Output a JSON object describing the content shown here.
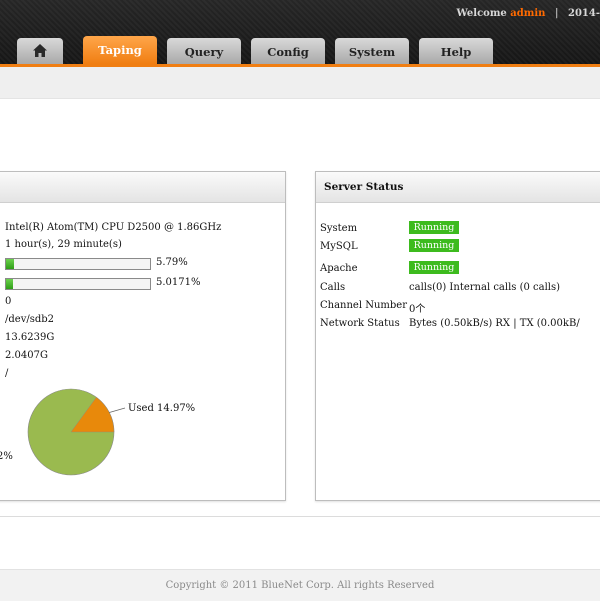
{
  "header": {
    "welcome_prefix": "Welcome",
    "username": "admin",
    "separator": "|",
    "date_fragment": "2014-"
  },
  "tabs": [
    {
      "label": "",
      "icon": "home-icon"
    },
    {
      "label": "Taping",
      "active": true
    },
    {
      "label": "Query"
    },
    {
      "label": "Config"
    },
    {
      "label": "System"
    },
    {
      "label": "Help"
    }
  ],
  "system_info": {
    "cpu": "Intel(R) Atom(TM) CPU D2500   @ 1.86GHz",
    "uptime": " 1 hour(s), 29 minute(s)",
    "usage_bars": [
      {
        "percent": 5.79,
        "label": "5.79%"
      },
      {
        "percent": 5.0171,
        "label": "5.0171%"
      }
    ],
    "values": [
      "0",
      "/dev/sdb2",
      "13.6239G",
      "2.0407G",
      "/"
    ],
    "disk_pie": {
      "used_fraction": 0.1497,
      "used_label": "Used 14.97%",
      "free_label_fragment": "2%",
      "colors": {
        "free": "#9aba4f",
        "used": "#e8890b"
      }
    }
  },
  "server_status": {
    "title": "Server Status",
    "services": [
      {
        "label": "System",
        "status": "Running"
      },
      {
        "label": "MySQL",
        "status": "Running"
      },
      {
        "label": "Apache",
        "status": "Running"
      }
    ],
    "calls": {
      "label": "Calls",
      "value": "calls(0) Internal calls (0 calls)"
    },
    "channel_number": {
      "label": "Channel Number",
      "value": "0个"
    },
    "network_status": {
      "label": "Network Status",
      "value": "Bytes (0.50kB/s) RX | TX (0.00kB/"
    }
  },
  "footer": {
    "copyright": "Copyright © 2011 BlueNet Corp. All rights Reserved"
  },
  "colors": {
    "accent": "#f07e12",
    "running": "#3dbb1e",
    "progress": "#2f9e17"
  }
}
